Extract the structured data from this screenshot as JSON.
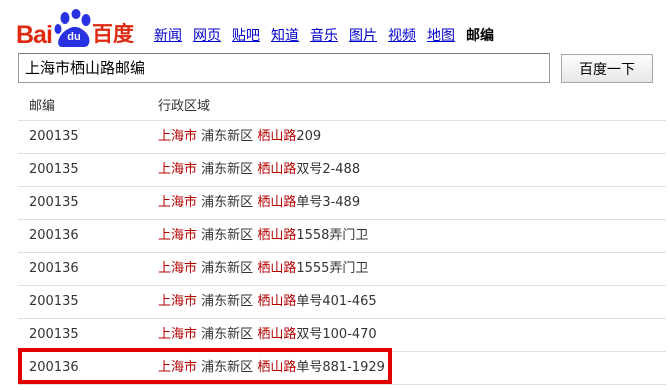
{
  "logo": {
    "bai": "Bai",
    "du": "du",
    "cn": "百度"
  },
  "nav": {
    "items": [
      "新闻",
      "网页",
      "贴吧",
      "知道",
      "音乐",
      "图片",
      "视频",
      "地图"
    ],
    "current": "邮编"
  },
  "search": {
    "value": "上海市栖山路邮编",
    "button": "百度一下"
  },
  "table": {
    "headers": [
      "邮编",
      "行政区域"
    ],
    "rows": [
      {
        "code": "200135",
        "city": "上海市",
        "district": "浦东新区",
        "road": "栖山路",
        "detail": "209"
      },
      {
        "code": "200135",
        "city": "上海市",
        "district": "浦东新区",
        "road": "栖山路",
        "detail": "双号2-488"
      },
      {
        "code": "200135",
        "city": "上海市",
        "district": "浦东新区",
        "road": "栖山路",
        "detail": "单号3-489"
      },
      {
        "code": "200136",
        "city": "上海市",
        "district": "浦东新区",
        "road": "栖山路",
        "detail": "1558弄门卫"
      },
      {
        "code": "200136",
        "city": "上海市",
        "district": "浦东新区",
        "road": "栖山路",
        "detail": "1555弄门卫"
      },
      {
        "code": "200135",
        "city": "上海市",
        "district": "浦东新区",
        "road": "栖山路",
        "detail": "单号401-465"
      },
      {
        "code": "200135",
        "city": "上海市",
        "district": "浦东新区",
        "road": "栖山路",
        "detail": "双号100-470"
      },
      {
        "code": "200136",
        "city": "上海市",
        "district": "浦东新区",
        "road": "栖山路",
        "detail": "单号881-1929"
      }
    ]
  },
  "colors": {
    "brand_red": "#de2910",
    "paw_blue": "#2932e1",
    "link_blue": "#0000cc",
    "highlight_red": "#b50000",
    "annotation_red": "#e00000"
  }
}
